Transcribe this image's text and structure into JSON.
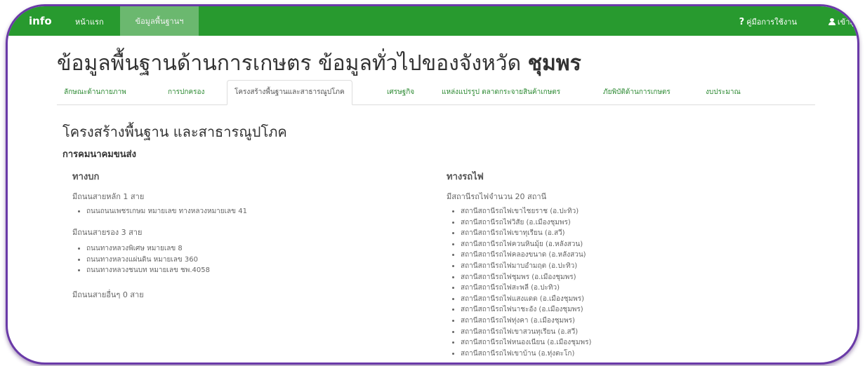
{
  "navbar": {
    "brand": "info",
    "home": "หน้าแรก",
    "basic_info": "ข้อมูลพื้นฐานฯ",
    "manual": "คู่มือการใช้งาน",
    "login": "เข้าสู่ร"
  },
  "page": {
    "title": "ข้อมูลพื้นฐานด้านการเกษตร ข้อมูลทั่วไปของจังหวัด",
    "province": "ชุมพร"
  },
  "tabs": [
    "ลักษณะด้านกายภาพ",
    "การปกครอง",
    "โครงสร้างพื้นฐานและสาธารณูปโภค",
    "เศรษฐกิจ",
    "แหล่งแปรรูป ตลาดกระจายสินค้าเกษตร",
    "ภัยพิบัติด้านการเกษตร",
    "งบประมาณ"
  ],
  "section": {
    "title": "โครงสร้างพื้นฐาน และสาธารณูปโภค",
    "subtitle": "การคมนาคมขนส่ง"
  },
  "road": {
    "heading": "ทางบก",
    "main_label": "มีถนนสายหลัก 1 สาย",
    "main_items": [
      "ถนนถนนเพชรเกษม หมายเลข ทางหลวงหมายเลข 41"
    ],
    "secondary_label": "มีถนนสายรอง 3 สาย",
    "secondary_items": [
      "ถนนทางหลวงพิเศษ หมายเลข 8",
      "ถนนทางหลวงแผ่นดิน หมายเลข 360",
      "ถนนทางหลวงชนบท หมายเลข ชพ.4058"
    ],
    "other_label": "มีถนนสายอื่นๆ 0 สาย"
  },
  "rail": {
    "heading": "ทางรถไฟ",
    "label": "มีสถานีรถไฟจำนวน 20 สถานี",
    "items": [
      "สถานีสถานีรถไฟเขาไชยราช (อ.ปะทิว)",
      "สถานีสถานีรถไฟวิสัย (อ.เมืองชุมพร)",
      "สถานีสถานีรถไฟเขาทุเรียน (อ.สวี)",
      "สถานีสถานีรถไฟควนหินมุ้ย (อ.หลังสวน)",
      "สถานีสถานีรถไฟคลองขนาด (อ.หลังสวน)",
      "สถานีสถานีรถไฟมาบอำมฤต (อ.ปะทิว)",
      "สถานีสถานีรถไฟชุมพร (อ.เมืองชุมพร)",
      "สถานีสถานีรถไฟสะพลี (อ.ปะทิว)",
      "สถานีสถานีรถไฟแสงแดด (อ.เมืองชุมพร)",
      "สถานีสถานีรถไฟนาชะอัง (อ.เมืองชุมพร)",
      "สถานีสถานีรถไฟทุ่งคา (อ.เมืองชุมพร)",
      "สถานีสถานีรถไฟเขาสวนทุเรียน (อ.สวี)",
      "สถานีสถานีรถไฟหนองเนียน (อ.เมืองชุมพร)",
      "สถานีสถานีรถไฟเขาบ้าน (อ.ทุ่งตะโก)"
    ]
  }
}
